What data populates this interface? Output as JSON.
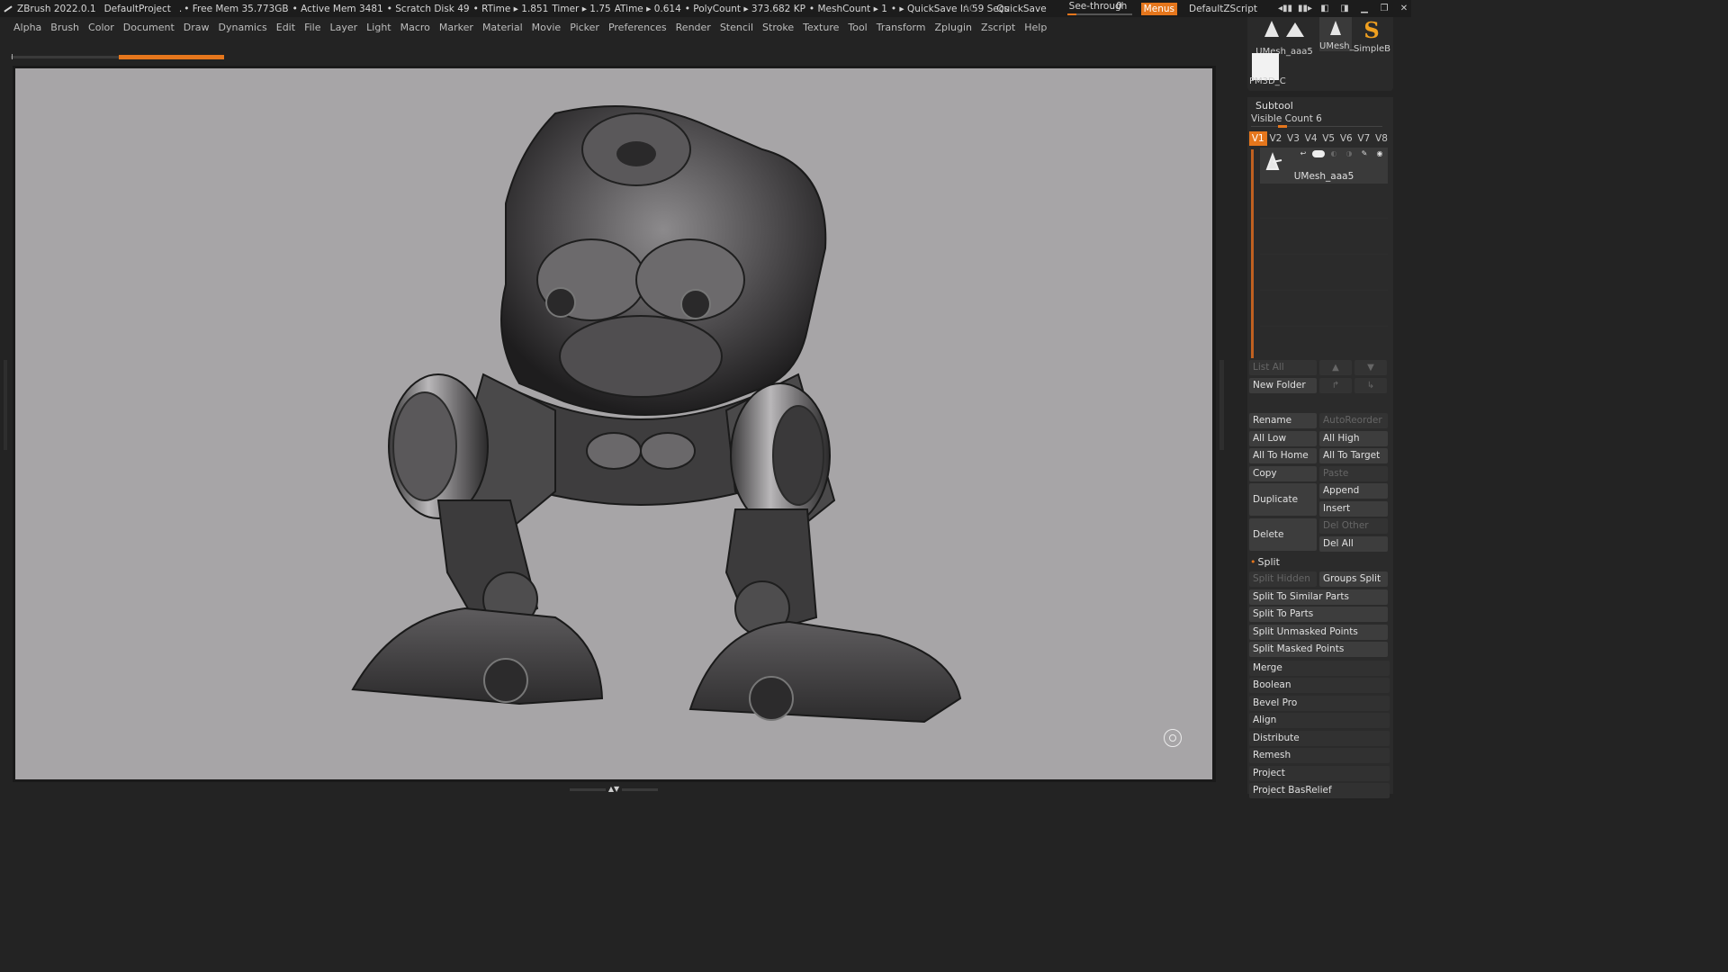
{
  "titlebar": {
    "app": "ZBrush 2022.0.1",
    "project": "DefaultProject",
    "dot": ".",
    "free_mem": "• Free Mem 35.773GB",
    "active_mem": "• Active Mem 3481",
    "scratch_disk": "• Scratch Disk 49",
    "rtime": "• RTime ▸ 1.851",
    "timer": "Timer ▸ 1.75",
    "atime": "ATime ▸ 0.614",
    "polycount": "• PolyCount ▸ 373.682 KP",
    "meshcount": "• MeshCount ▸ 1",
    "quicksave_timer": "• ▸ QuickSave In 59 Secs",
    "ac": "AC",
    "quicksave": "QuickSave",
    "seethrough_label": "See-through",
    "seethrough_value": "0",
    "seethrough_level": 0,
    "menus": "Menus",
    "script": "DefaultZScript"
  },
  "menu": [
    "Alpha",
    "Brush",
    "Color",
    "Document",
    "Draw",
    "Dynamics",
    "Edit",
    "File",
    "Layer",
    "Light",
    "Macro",
    "Marker",
    "Material",
    "Movie",
    "Picker",
    "Preferences",
    "Render",
    "Stencil",
    "Stroke",
    "Texture",
    "Tool",
    "Transform",
    "Zplugin",
    "Zscript",
    "Help"
  ],
  "tool_thumbs": [
    {
      "label": "UMesh_aaa5"
    },
    {
      "label": "UMesh_"
    },
    {
      "label": "SimpleB"
    },
    {
      "label": "PM3D_C"
    }
  ],
  "subtool": {
    "title": "Subtool",
    "visible_count": "Visible Count 6",
    "vtabs": [
      "V1",
      "V2",
      "V3",
      "V4",
      "V5",
      "V6",
      "V7",
      "V8"
    ],
    "active_vtab": "V1",
    "items": [
      {
        "name": "UMesh_aaa5"
      }
    ],
    "list_all": "List All",
    "new_folder": "New Folder",
    "rename": "Rename",
    "auto_reorder": "AutoReorder",
    "all_low": "All Low",
    "all_high": "All High",
    "all_to_home": "All To Home",
    "all_to_target": "All To Target",
    "copy": "Copy",
    "paste": "Paste",
    "duplicate": "Duplicate",
    "append": "Append",
    "insert": "Insert",
    "delete": "Delete",
    "del_other": "Del Other",
    "del_all": "Del All",
    "split": "Split",
    "split_hidden": "Split Hidden",
    "groups_split": "Groups Split",
    "split_to_similar": "Split To Similar Parts",
    "split_to_parts": "Split To Parts",
    "split_unmasked": "Split Unmasked Points",
    "split_masked": "Split Masked Points",
    "merge": "Merge",
    "boolean": "Boolean",
    "bevel_pro": "Bevel Pro",
    "align": "Align",
    "distribute": "Distribute",
    "remesh": "Remesh",
    "project": "Project",
    "project_basrelief": "Project BasRelief"
  },
  "colors": {
    "accent": "#e5761c",
    "canvas_bg": "#a7a5a7",
    "panel_bg": "#2b2b2b",
    "app_bg": "#232323"
  },
  "icons": [
    "zbrush-logo-icon",
    "minimize-icon",
    "restore-icon",
    "close-icon",
    "navigation-gizmo-icon",
    "eye-icon",
    "brush-icon",
    "arrow-up-icon",
    "arrow-down-icon"
  ]
}
